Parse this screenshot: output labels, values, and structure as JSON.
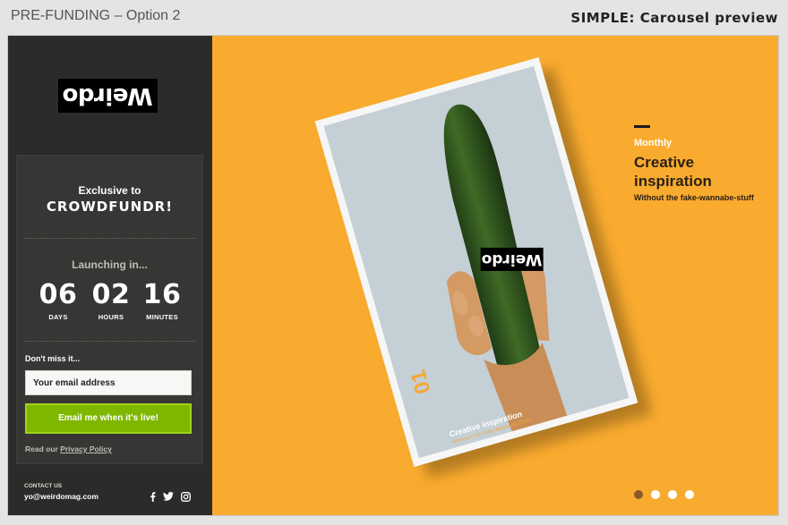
{
  "header": {
    "doc_title": "PRE-FUNDING – Option 2",
    "preview_title": "SIMPLE: Carousel preview"
  },
  "sidebar": {
    "logo_text": "Weirdo",
    "exclusive_line1": "Exclusive to",
    "exclusive_line2": "CROWDFUNDR!",
    "launching_label": "Launching in...",
    "countdown": [
      {
        "value": "06",
        "unit": "DAYS"
      },
      {
        "value": "02",
        "unit": "HOURS"
      },
      {
        "value": "16",
        "unit": "MINUTES"
      }
    ],
    "dont_miss": "Don't miss it...",
    "email_placeholder": "Your email address",
    "cta_label": "Email me when it's live!",
    "privacy_prefix": "Read our ",
    "privacy_link": "Privacy Policy",
    "contact_label": "CONTACT US",
    "contact_email": "yo@weirdomag.com",
    "social_icons": [
      "facebook-icon",
      "twitter-icon",
      "instagram-icon"
    ]
  },
  "slide": {
    "cover_logo": "Weirdo",
    "cover_issue": "01",
    "cover_title": "Creative inspiration",
    "cover_subtitle": "WITHOUT THE FAKE-WANNABE-STUFF",
    "kicker": "Monthly",
    "headline_line1": "Creative",
    "headline_line2": "inspiration",
    "tagline": "Without the fake-wannabe-stuff",
    "pager_count": 4,
    "pager_active_index": 0
  },
  "colors": {
    "accent": "#f9ab2f",
    "sidebar_bg": "#2b2b29",
    "cta_green": "#7fb600"
  }
}
